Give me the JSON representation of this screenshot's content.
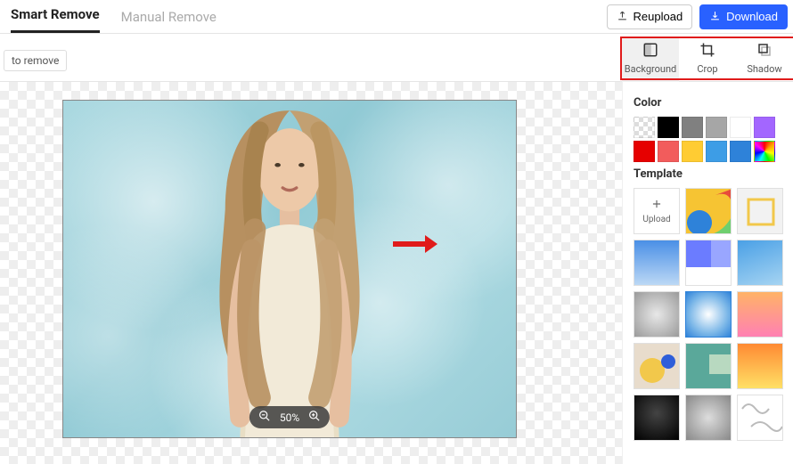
{
  "tabs": {
    "smart": "Smart Remove",
    "manual": "Manual Remove"
  },
  "actions": {
    "reupload": "Reupload",
    "download": "Download"
  },
  "chip": "to remove",
  "tooltabs": {
    "background": "Background",
    "crop": "Crop",
    "shadow": "Shadow"
  },
  "zoom": {
    "level": "50%"
  },
  "panel": {
    "color_heading": "Color",
    "template_heading": "Template",
    "upload_label": "Upload",
    "colors_row1": [
      "transparent",
      "#000000",
      "#808080",
      "#a6a6a6",
      "#ffffff",
      "#a366ff"
    ],
    "colors_row2": [
      "#e60000",
      "#f25c5c",
      "#ffcc33",
      "#3d9de6",
      "#2e82d9",
      "rainbow"
    ]
  }
}
